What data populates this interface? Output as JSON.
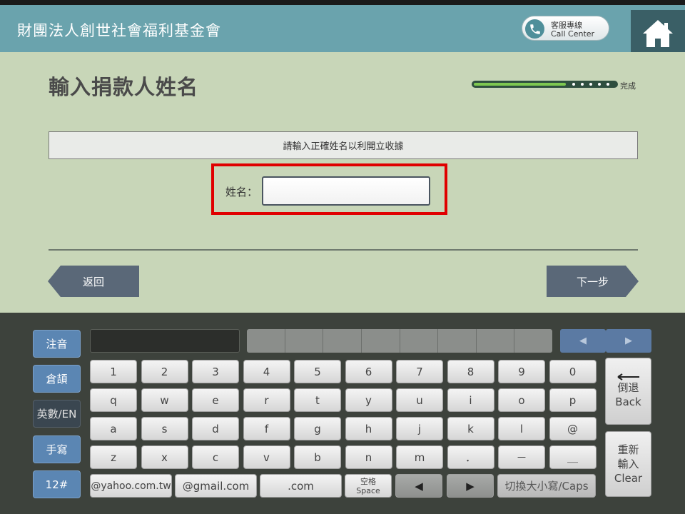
{
  "header": {
    "title": "財團法人創世社會福利基金會",
    "call_center_line1": "客服專線",
    "call_center_line2": "Call Center"
  },
  "page": {
    "title": "輸入捐款人姓名",
    "progress_label": "完成",
    "progress_fraction": 0.65,
    "notice": "請輸入正確姓名以利開立收據",
    "name_label": "姓名：",
    "name_value": "",
    "back_label": "返回",
    "next_label": "下一步"
  },
  "keyboard": {
    "modes": [
      "注音",
      "倉頡",
      "英數/EN",
      "手寫",
      "12#"
    ],
    "active_mode": "英數/EN",
    "arrow_left": "◀",
    "arrow_right": "▶",
    "row_numbers": [
      "1",
      "2",
      "3",
      "4",
      "5",
      "6",
      "7",
      "8",
      "9",
      "0"
    ],
    "row_q": [
      "q",
      "w",
      "e",
      "r",
      "t",
      "y",
      "u",
      "i",
      "o",
      "p"
    ],
    "row_a": [
      "a",
      "s",
      "d",
      "f",
      "g",
      "h",
      "j",
      "k",
      "l",
      "@"
    ],
    "row_z": [
      "z",
      "x",
      "c",
      "v",
      "b",
      "n",
      "m",
      "．",
      "－",
      "＿"
    ],
    "backspace_line1": "倒退",
    "backspace_line2": "Back",
    "clear_line1": "重新",
    "clear_line2": "輸入",
    "clear_line3": "Clear",
    "yahoo": "@yahoo.com.tw",
    "gmail": "@gmail.com",
    "dotcom": ".com",
    "space_line1": "空格",
    "space_line2": "Space",
    "cursor_left": "◀",
    "cursor_right": "▶",
    "caps": "切換大小寫/Caps"
  }
}
